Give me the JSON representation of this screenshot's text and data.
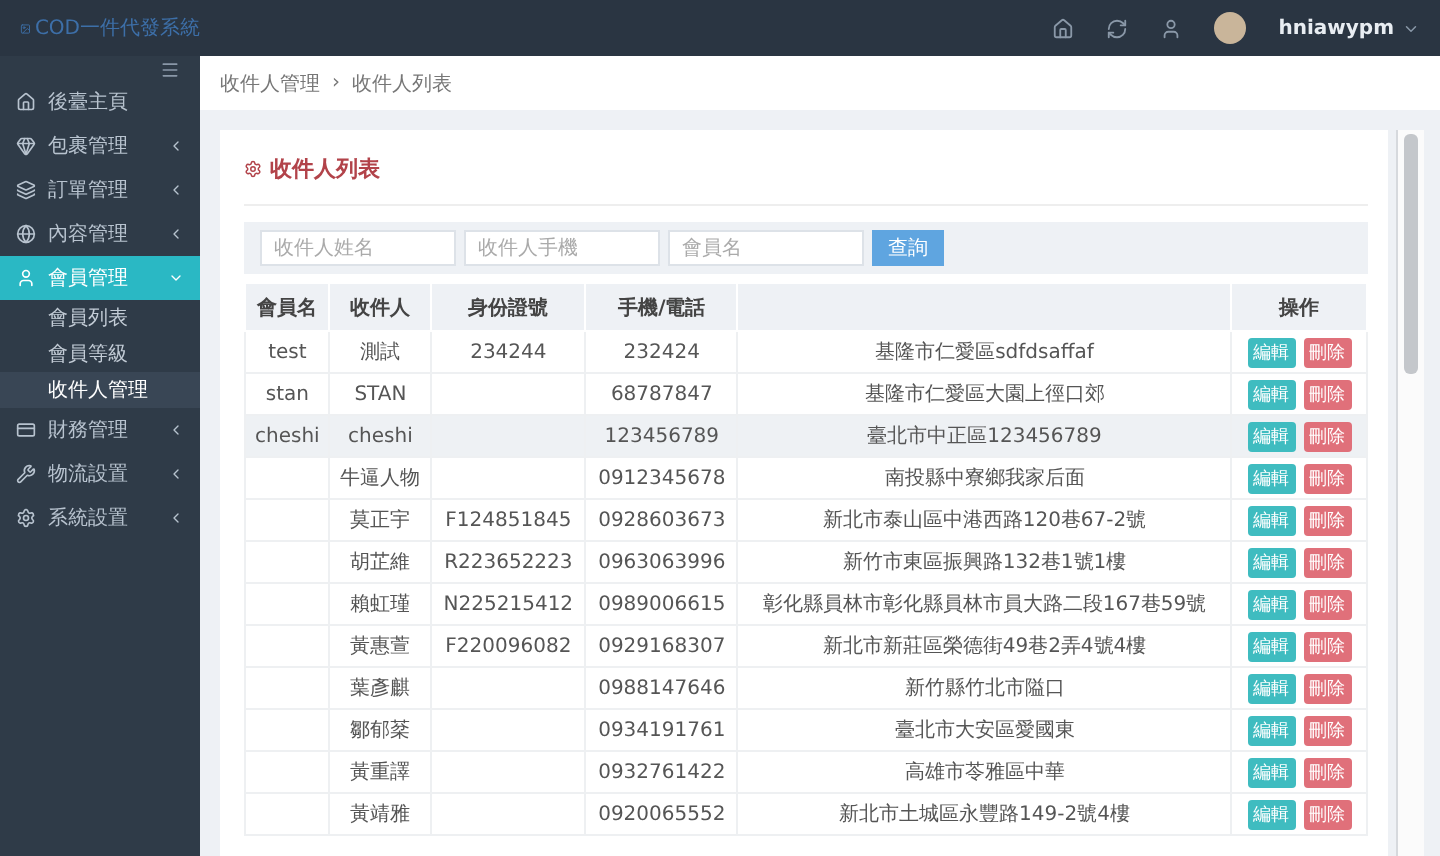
{
  "brand": {
    "logo_alt": "COD一件代發系統"
  },
  "topbar": {
    "username": "hniawypm"
  },
  "sidebar": {
    "items": [
      {
        "label": "後臺主頁",
        "kind": "link",
        "expanded": false
      },
      {
        "label": "包裹管理",
        "kind": "group",
        "expanded": false
      },
      {
        "label": "訂單管理",
        "kind": "group",
        "expanded": false
      },
      {
        "label": "內容管理",
        "kind": "group",
        "expanded": false
      },
      {
        "label": "會員管理",
        "kind": "group",
        "expanded": true,
        "children": [
          {
            "label": "會員列表",
            "selected": false
          },
          {
            "label": "會員等級",
            "selected": false
          },
          {
            "label": "收件人管理",
            "selected": true
          }
        ]
      },
      {
        "label": "財務管理",
        "kind": "group",
        "expanded": false
      },
      {
        "label": "物流設置",
        "kind": "group",
        "expanded": false
      },
      {
        "label": "系統設置",
        "kind": "group",
        "expanded": false
      }
    ]
  },
  "breadcrumb": {
    "items": [
      "收件人管理",
      "收件人列表"
    ],
    "separator": "›"
  },
  "panel_title": "收件人列表",
  "filters": [
    {
      "placeholder": "收件人姓名"
    },
    {
      "placeholder": "收件人手機"
    },
    {
      "placeholder": "會員名"
    }
  ],
  "search_button": "查詢",
  "table": {
    "columns": [
      "會員名",
      "收件人",
      "身份證號",
      "手機/電話",
      "",
      "操作"
    ],
    "rows": [
      {
        "member": "test",
        "recipient": "測試",
        "id_number": "234244",
        "phone": "232424",
        "address": "基隆市仁愛區sdfdsaffaf",
        "selected": false,
        "actions": [
          "編輯",
          "刪除"
        ]
      },
      {
        "member": "stan",
        "recipient": "STAN",
        "id_number": "",
        "phone": "68787847",
        "address": "基隆市仁愛區大園上徑口郊",
        "selected": false,
        "actions": [
          "編輯",
          "刪除"
        ]
      },
      {
        "member": "cheshi",
        "recipient": "cheshi",
        "id_number": "",
        "phone": "123456789",
        "address": "臺北市中正區123456789",
        "selected": true,
        "actions": [
          "編輯",
          "刪除"
        ]
      },
      {
        "member": "",
        "recipient": "牛逼人物",
        "id_number": "",
        "phone": "0912345678",
        "address": "南投縣中寮鄉我家后面",
        "selected": false,
        "actions": [
          "編輯",
          "刪除"
        ]
      },
      {
        "member": "",
        "recipient": "莫正宇",
        "id_number": "F124851845",
        "phone": "0928603673",
        "address": "新北市泰山區中港西路120巷67-2號",
        "selected": false,
        "actions": [
          "編輯",
          "刪除"
        ]
      },
      {
        "member": "",
        "recipient": "胡芷維",
        "id_number": "R223652223",
        "phone": "0963063996",
        "address": "新竹市東區振興路132巷1號1樓",
        "selected": false,
        "actions": [
          "編輯",
          "刪除"
        ]
      },
      {
        "member": "",
        "recipient": "賴虹瑾",
        "id_number": "N225215412",
        "phone": "0989006615",
        "address": "彰化縣員林市彰化縣員林市員大路二段167巷59號",
        "selected": false,
        "actions": [
          "編輯",
          "刪除"
        ]
      },
      {
        "member": "",
        "recipient": "黃惠萱",
        "id_number": "F220096082",
        "phone": "0929168307",
        "address": "新北市新莊區榮德街49巷2弄4號4樓",
        "selected": false,
        "actions": [
          "編輯",
          "刪除"
        ]
      },
      {
        "member": "",
        "recipient": "葉彥麒",
        "id_number": "",
        "phone": "0988147646",
        "address": "新竹縣竹北市隘口",
        "selected": false,
        "actions": [
          "編輯",
          "刪除"
        ]
      },
      {
        "member": "",
        "recipient": "鄒郁棻",
        "id_number": "",
        "phone": "0934191761",
        "address": "臺北市大安區愛國東",
        "selected": false,
        "actions": [
          "編輯",
          "刪除"
        ]
      },
      {
        "member": "",
        "recipient": "黃重譯",
        "id_number": "",
        "phone": "0932761422",
        "address": "高雄市苓雅區中華",
        "selected": false,
        "actions": [
          "編輯",
          "刪除"
        ]
      },
      {
        "member": "",
        "recipient": "黃靖雅",
        "id_number": "",
        "phone": "0920065552",
        "address": "新北市土城區永豐路149-2號4樓",
        "selected": false,
        "actions": [
          "編輯",
          "刪除"
        ]
      }
    ]
  }
}
